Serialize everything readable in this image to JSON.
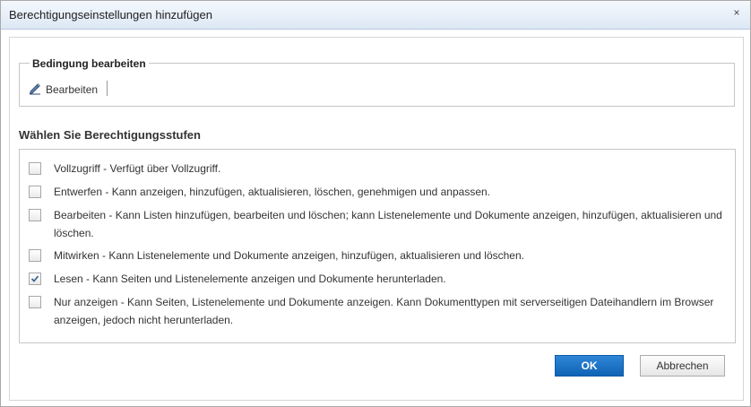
{
  "dialog": {
    "title": "Berechtigungseinstellungen hinzufügen",
    "close_glyph": "×"
  },
  "condition": {
    "legend": "Bedingung bearbeiten",
    "edit_label": "Bearbeiten",
    "edit_icon": "pencil-icon"
  },
  "permissions": {
    "heading": "Wählen Sie Berechtigungsstufen",
    "levels": [
      {
        "text": "Vollzugriff - Verfügt über Vollzugriff.",
        "checked": false
      },
      {
        "text": "Entwerfen - Kann anzeigen, hinzufügen, aktualisieren, löschen, genehmigen und anpassen.",
        "checked": false
      },
      {
        "text": "Bearbeiten - Kann Listen hinzufügen, bearbeiten und löschen; kann Listenelemente und Dokumente anzeigen, hinzufügen, aktualisieren und löschen.",
        "checked": false
      },
      {
        "text": "Mitwirken - Kann Listenelemente und Dokumente anzeigen, hinzufügen, aktualisieren und löschen.",
        "checked": false
      },
      {
        "text": "Lesen - Kann Seiten und Listenelemente anzeigen und Dokumente herunterladen.",
        "checked": true
      },
      {
        "text": "Nur anzeigen - Kann Seiten, Listenelemente und Dokumente anzeigen. Kann Dokumenttypen mit serverseitigen Dateihandlern im Browser anzeigen, jedoch nicht herunterladen.",
        "checked": false
      }
    ]
  },
  "buttons": {
    "ok_label": "OK",
    "cancel_label": "Abbrechen"
  },
  "colors": {
    "accent": "#1a6fc1",
    "titlebar": "#dde8f5",
    "border": "#c6c6c6"
  }
}
